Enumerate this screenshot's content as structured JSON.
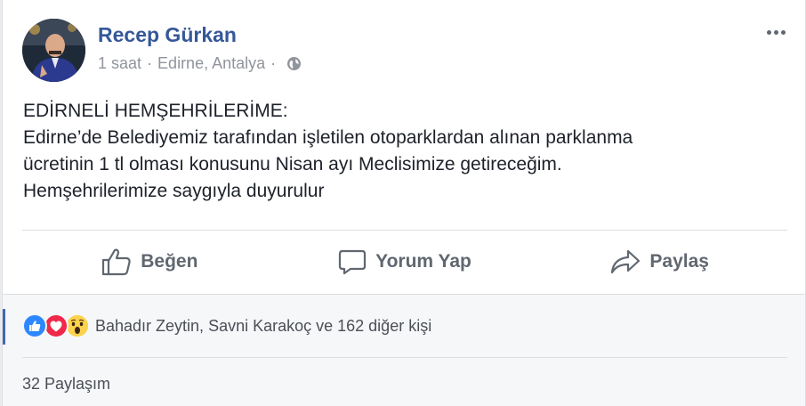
{
  "post": {
    "author": "Recep Gürkan",
    "time": "1 saat",
    "location": "Edirne, Antalya",
    "privacy_icon": "globe-icon",
    "lines": [
      "EDİRNELİ HEMŞEHRİLERİME:",
      "Edirne’de Belediyemiz tarafından işletilen otoparklardan alınan parklanma",
      "ücretinin 1 tl olması konusunu Nisan ayı Meclisimize getireceğim.",
      "Hemşehrilerimize saygıyla duyurulur"
    ]
  },
  "actions": {
    "like": "Beğen",
    "comment": "Yorum Yap",
    "share": "Paylaş"
  },
  "reactions": {
    "icons": [
      "like-reaction-icon",
      "love-reaction-icon",
      "wow-reaction-icon"
    ],
    "summary": "Bahadır Zeytin, Savni Karakoç ve 162 diğer kişi"
  },
  "shares": "32 Paylaşım",
  "colors": {
    "author": "#365899",
    "meta": "#90949c",
    "action": "#606770",
    "like": "#2d88ff",
    "love": "#f0284a",
    "wow": "#fcd34d"
  }
}
